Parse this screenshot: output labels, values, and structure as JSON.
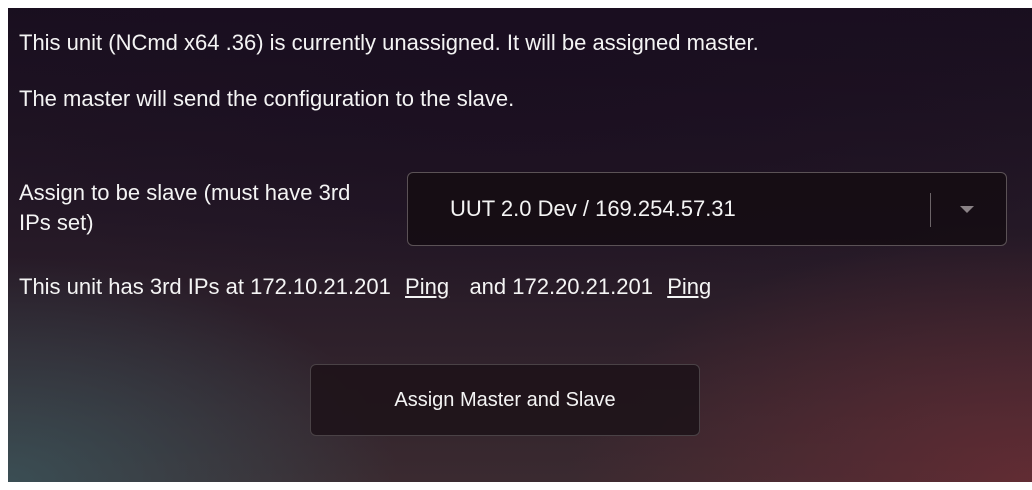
{
  "intro": {
    "line1": "This unit (NCmd x64 .36) is currently unassigned. It will be assigned master.",
    "line2": "The master will send the configuration to the slave."
  },
  "slave_select": {
    "label": "Assign to be slave (must have 3rd IPs set)",
    "selected_value": "UUT 2.0 Dev / 169.254.57.31",
    "dropdown_icon": "chevron-down-icon"
  },
  "ips": {
    "prefix": "This unit has 3rd IPs at 172.10.21.201",
    "ping1_label": "Ping",
    "middle": "and 172.20.21.201",
    "ping2_label": "Ping"
  },
  "actions": {
    "assign_label": "Assign Master and Slave"
  }
}
